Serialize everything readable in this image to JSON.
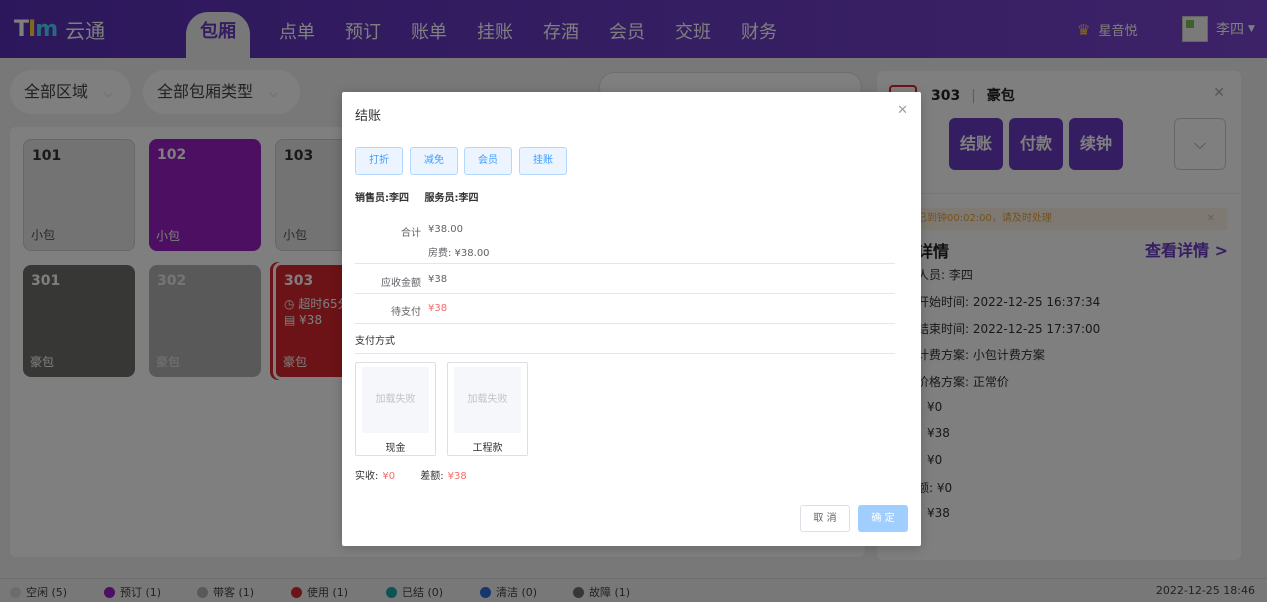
{
  "logo": {
    "text": "云通"
  },
  "nav": {
    "items": [
      "包厢",
      "点单",
      "预订",
      "账单",
      "挂账",
      "存酒",
      "会员",
      "交班",
      "财务"
    ],
    "active": "包厢"
  },
  "header": {
    "store_name": "星音悦",
    "user_name": "李四"
  },
  "filters": {
    "area": "全部区域",
    "room_type": "全部包厢类型"
  },
  "rooms": [
    {
      "num": "101",
      "type": "小包",
      "status": "idle"
    },
    {
      "num": "102",
      "type": "小包",
      "status": "reserved"
    },
    {
      "num": "103",
      "type": "小包",
      "status": "idle"
    },
    {
      "num": "301",
      "type": "豪包",
      "status": "fault"
    },
    {
      "num": "302",
      "type": "豪包",
      "status": "waiting"
    },
    {
      "num": "303",
      "type": "豪包",
      "status": "using",
      "timeout": "超时65分",
      "amount": "¥38"
    }
  ],
  "side": {
    "room_num": "303",
    "room_type": "豪包",
    "actions": [
      "单",
      "结账",
      "付款",
      "续钟"
    ],
    "warning": "已到钟00:02:00，请及时处理",
    "detail_title": "详情",
    "detail_link": "查看详情 >",
    "rows": [
      "人员: 李四",
      "开始时间: 2022-12-25 16:37:34",
      "结束时间: 2022-12-25 17:37:00",
      "计费方案: 小包计费方案",
      "价格方案: 正常价",
      "¥0",
      "¥38",
      "¥0",
      "额: ¥0",
      "¥38"
    ]
  },
  "dialog": {
    "title": "结账",
    "tools": [
      "打折",
      "减免",
      "会员",
      "挂账"
    ],
    "seller": "销售员:李四",
    "server": "服务员:李四",
    "total_label": "合计",
    "total_value": "¥38.00",
    "room_fee": "房费: ¥38.00",
    "receivable_label": "应收金额",
    "receivable_value": "¥38",
    "pending_label": "待支付",
    "pending_value": "¥38",
    "pay_method_title": "支付方式",
    "pay_methods": [
      {
        "name": "现金",
        "img_text": "加载失败"
      },
      {
        "name": "工程款",
        "img_text": "加载失败"
      }
    ],
    "paid_label": "实收:",
    "paid_value": "¥0",
    "diff_label": "差额:",
    "diff_value": "¥38",
    "cancel_label": "取 消",
    "ok_label": "确 定"
  },
  "statusbar": {
    "items": [
      {
        "label": "空闲 (5)",
        "color": "#d9d9d9"
      },
      {
        "label": "预订 (1)",
        "color": "#9b1ec4"
      },
      {
        "label": "带客 (1)",
        "color": "#b3b3b3"
      },
      {
        "label": "使用 (1)",
        "color": "#d8262e"
      },
      {
        "label": "已结 (0)",
        "color": "#1aa6a6"
      },
      {
        "label": "清洁 (0)",
        "color": "#2a6fd6"
      },
      {
        "label": "故障 (1)",
        "color": "#6f6f6a"
      }
    ],
    "clock": "2022-12-25 18:46"
  }
}
